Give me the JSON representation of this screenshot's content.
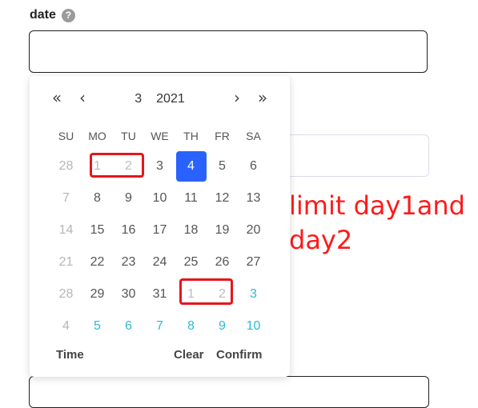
{
  "field": {
    "label": "date",
    "help_icon": "?"
  },
  "calendar": {
    "month": "3",
    "year": "2021",
    "nav": {
      "prev_year": "«",
      "prev_month": "‹",
      "next_month": "›",
      "next_year": "»"
    },
    "weekdays": [
      "SU",
      "MO",
      "TU",
      "WE",
      "TH",
      "FR",
      "SA"
    ],
    "weeks": [
      [
        {
          "d": "28",
          "t": "prev"
        },
        {
          "d": "1",
          "t": "disabled"
        },
        {
          "d": "2",
          "t": "disabled"
        },
        {
          "d": "3",
          "t": "current"
        },
        {
          "d": "4",
          "t": "today"
        },
        {
          "d": "5",
          "t": "current"
        },
        {
          "d": "6",
          "t": "current"
        }
      ],
      [
        {
          "d": "7",
          "t": "prev"
        },
        {
          "d": "8",
          "t": "current"
        },
        {
          "d": "9",
          "t": "current"
        },
        {
          "d": "10",
          "t": "current"
        },
        {
          "d": "11",
          "t": "current"
        },
        {
          "d": "12",
          "t": "current"
        },
        {
          "d": "13",
          "t": "current"
        }
      ],
      [
        {
          "d": "14",
          "t": "prev"
        },
        {
          "d": "15",
          "t": "current"
        },
        {
          "d": "16",
          "t": "current"
        },
        {
          "d": "17",
          "t": "current"
        },
        {
          "d": "18",
          "t": "current"
        },
        {
          "d": "19",
          "t": "current"
        },
        {
          "d": "20",
          "t": "current"
        }
      ],
      [
        {
          "d": "21",
          "t": "prev"
        },
        {
          "d": "22",
          "t": "current"
        },
        {
          "d": "23",
          "t": "current"
        },
        {
          "d": "24",
          "t": "current"
        },
        {
          "d": "25",
          "t": "current"
        },
        {
          "d": "26",
          "t": "current"
        },
        {
          "d": "27",
          "t": "current"
        }
      ],
      [
        {
          "d": "28",
          "t": "prev"
        },
        {
          "d": "29",
          "t": "current"
        },
        {
          "d": "30",
          "t": "current"
        },
        {
          "d": "31",
          "t": "current"
        },
        {
          "d": "1",
          "t": "disabled"
        },
        {
          "d": "2",
          "t": "disabled"
        },
        {
          "d": "3",
          "t": "next"
        }
      ],
      [
        {
          "d": "4",
          "t": "prev"
        },
        {
          "d": "5",
          "t": "next"
        },
        {
          "d": "6",
          "t": "next"
        },
        {
          "d": "7",
          "t": "next"
        },
        {
          "d": "8",
          "t": "next"
        },
        {
          "d": "9",
          "t": "next"
        },
        {
          "d": "10",
          "t": "next"
        }
      ]
    ],
    "footer": {
      "time": "Time",
      "clear": "Clear",
      "confirm": "Confirm"
    }
  },
  "annotation": {
    "line1": "limit day1and",
    "line2": "day2"
  },
  "colors": {
    "today_bg": "#2962ff",
    "next_month_text": "#2fb8d6",
    "annotation": "#ff1a1a",
    "highlight_box": "#e8141c"
  }
}
